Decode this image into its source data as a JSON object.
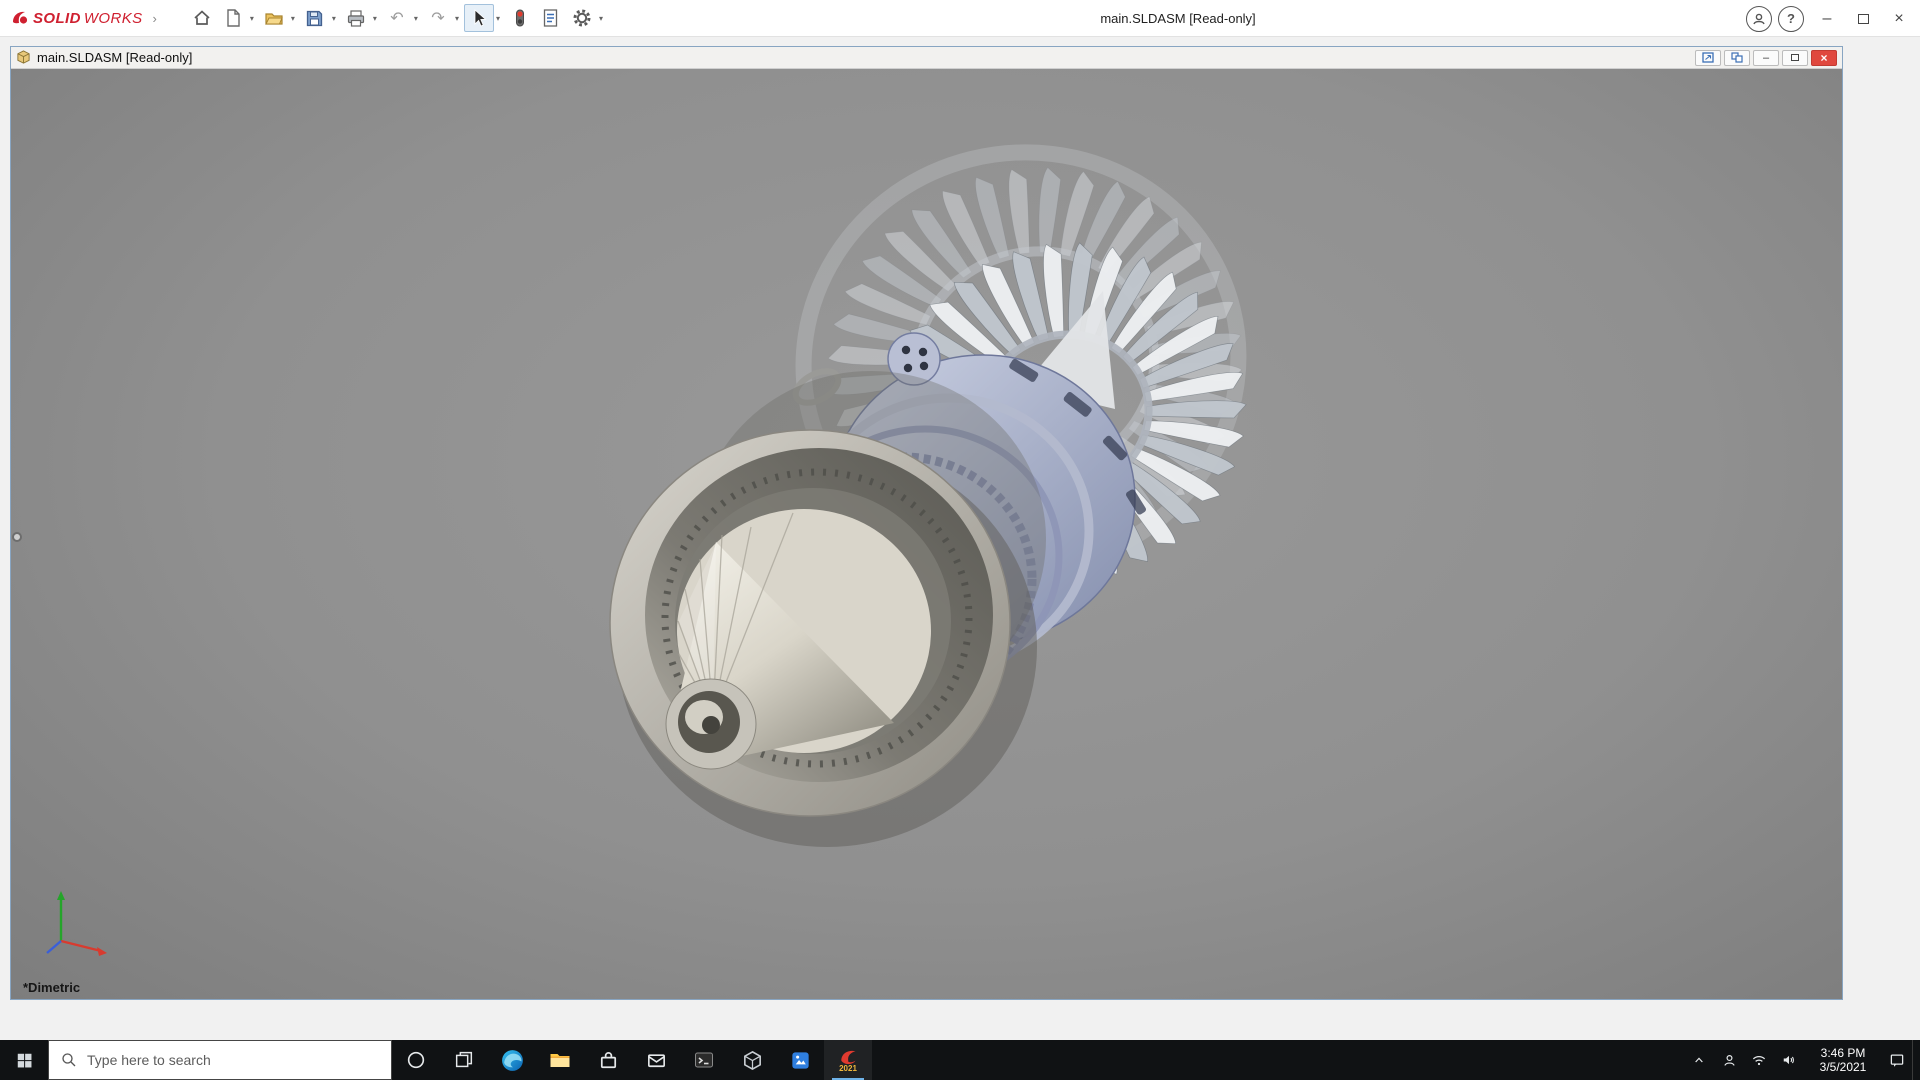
{
  "titlebar": {
    "brand": {
      "solid": "SOLID",
      "works": "WORKS"
    },
    "document_title": "main.SLDASM [Read-only]",
    "glyphs": {
      "dropdown": "▾",
      "undo": "↶",
      "redo": "↷",
      "minimize": "–",
      "close": "×",
      "help": "?",
      "expand": "›"
    }
  },
  "doc_window": {
    "title": "main.SLDASM [Read-only]",
    "glyphs": {
      "minimize": "–",
      "close": "×"
    }
  },
  "viewport": {
    "orientation_label": "*Dimetric"
  },
  "taskbar": {
    "search_placeholder": "Type here to search",
    "clock": {
      "time": "3:46 PM",
      "date": "3/5/2021"
    },
    "solidworks_year": "2021"
  }
}
